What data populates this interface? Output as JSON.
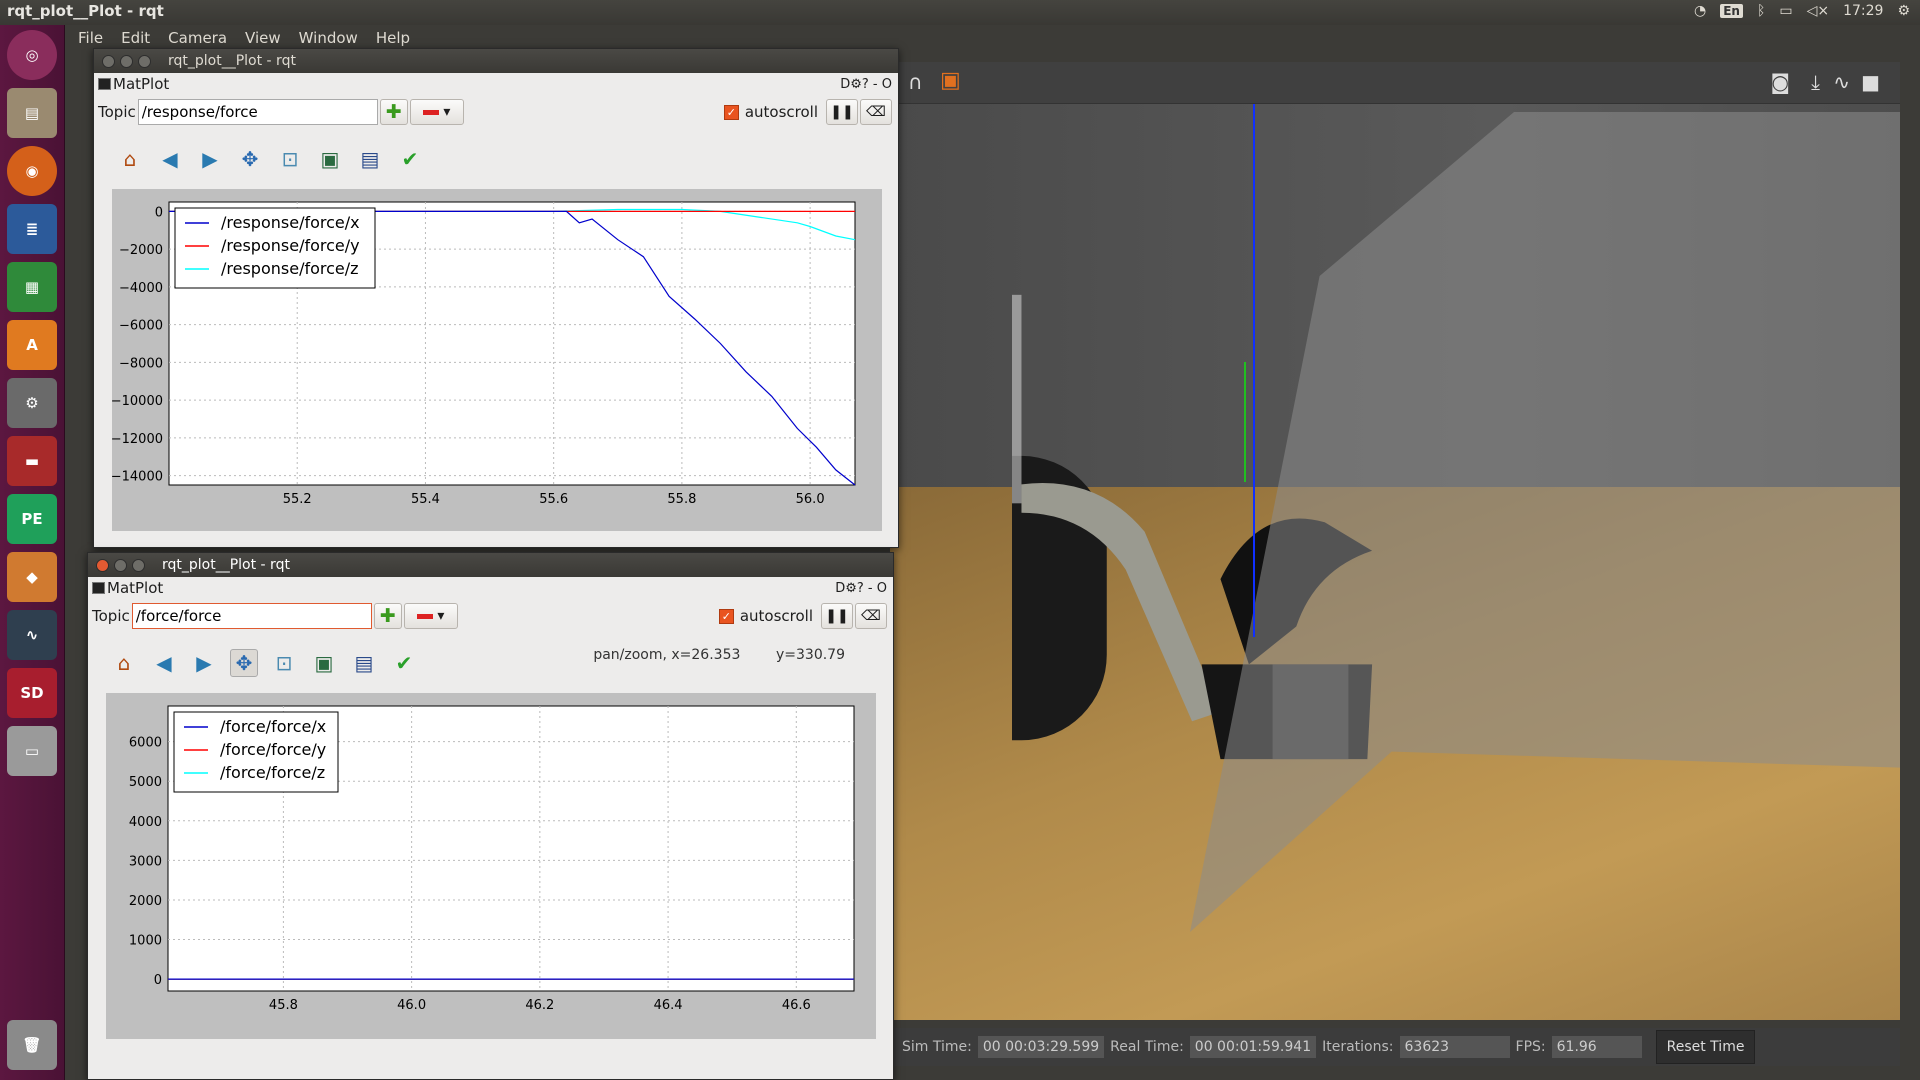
{
  "topbar": {
    "title": "rqt_plot__Plot - rqt",
    "keyboard": "En",
    "time": "17:29"
  },
  "menubar": [
    "File",
    "Edit",
    "Camera",
    "View",
    "Window",
    "Help"
  ],
  "launcher": [
    "ubuntu-logo",
    "files",
    "firefox",
    "writer",
    "calc",
    "software-center",
    "system-settings",
    "terminal",
    "pycharm",
    "blender",
    "system-monitor",
    "sd-card",
    "disk",
    "trash"
  ],
  "gazebo": {
    "sim_time_label": "Sim Time:",
    "sim_time": "00 00:03:29.599",
    "real_time_label": "Real Time:",
    "real_time": "00 00:01:59.941",
    "iterations_label": "Iterations:",
    "iterations": "63623",
    "fps_label": "FPS:",
    "fps": "61.96",
    "reset_label": "Reset Time"
  },
  "window1": {
    "title": "rqt_plot__Plot - rqt",
    "plugin": "MatPlot",
    "plugin_controls": "D⚙?  - O",
    "topic_label": "Topic",
    "topic_value": "/response/force",
    "autoscroll_label": "autoscroll"
  },
  "window2": {
    "title": "rqt_plot__Plot - rqt",
    "plugin": "MatPlot",
    "plugin_controls": "D⚙?  - O",
    "topic_label": "Topic",
    "topic_value": "/force/force",
    "autoscroll_label": "autoscroll",
    "coords": "pan/zoom, x=26.353        y=330.79"
  },
  "colors": {
    "x": "#0000cc",
    "y": "#ff0000",
    "z": "#00ffff"
  },
  "chart_data": [
    {
      "type": "line",
      "title": "",
      "xlim": [
        55.0,
        56.07
      ],
      "ylim": [
        -14500,
        500
      ],
      "xticks": [
        55.2,
        55.4,
        55.6,
        55.8,
        56.0
      ],
      "yticks": [
        0,
        -2000,
        -4000,
        -6000,
        -8000,
        -10000,
        -12000,
        -14000
      ],
      "legend_position": "upper-left",
      "grid": true,
      "series": [
        {
          "name": "/response/force/x",
          "color": "#0000cc",
          "x": [
            55.0,
            55.62,
            55.64,
            55.66,
            55.7,
            55.74,
            55.78,
            55.82,
            55.86,
            55.9,
            55.94,
            55.98,
            56.01,
            56.04,
            56.07
          ],
          "y": [
            0,
            0,
            -600,
            -400,
            -1500,
            -2400,
            -4500,
            -5700,
            -7000,
            -8500,
            -9800,
            -11500,
            -12500,
            -13700,
            -14500
          ]
        },
        {
          "name": "/response/force/y",
          "color": "#ff0000",
          "x": [
            55.0,
            56.07
          ],
          "y": [
            0,
            0
          ]
        },
        {
          "name": "/response/force/z",
          "color": "#00ffff",
          "x": [
            55.0,
            55.6,
            55.7,
            55.8,
            55.86,
            55.92,
            55.98,
            56.0,
            56.04,
            56.07
          ],
          "y": [
            0,
            0,
            100,
            100,
            0,
            -300,
            -600,
            -800,
            -1300,
            -1500
          ]
        }
      ]
    },
    {
      "type": "line",
      "title": "",
      "xlim": [
        45.62,
        46.69
      ],
      "ylim": [
        -300,
        6900
      ],
      "xticks": [
        45.8,
        46.0,
        46.2,
        46.4,
        46.6
      ],
      "yticks": [
        0,
        1000,
        2000,
        3000,
        4000,
        5000,
        6000
      ],
      "legend_position": "upper-left",
      "grid": true,
      "series": [
        {
          "name": "/force/force/x",
          "color": "#0000cc",
          "x": [
            45.62,
            46.69
          ],
          "y": [
            0,
            0
          ]
        },
        {
          "name": "/force/force/y",
          "color": "#ff0000",
          "x": [
            45.62,
            46.69
          ],
          "y": [
            0,
            0
          ]
        },
        {
          "name": "/force/force/z",
          "color": "#00ffff",
          "x": [
            45.62,
            46.69
          ],
          "y": [
            0,
            0
          ]
        }
      ]
    }
  ]
}
